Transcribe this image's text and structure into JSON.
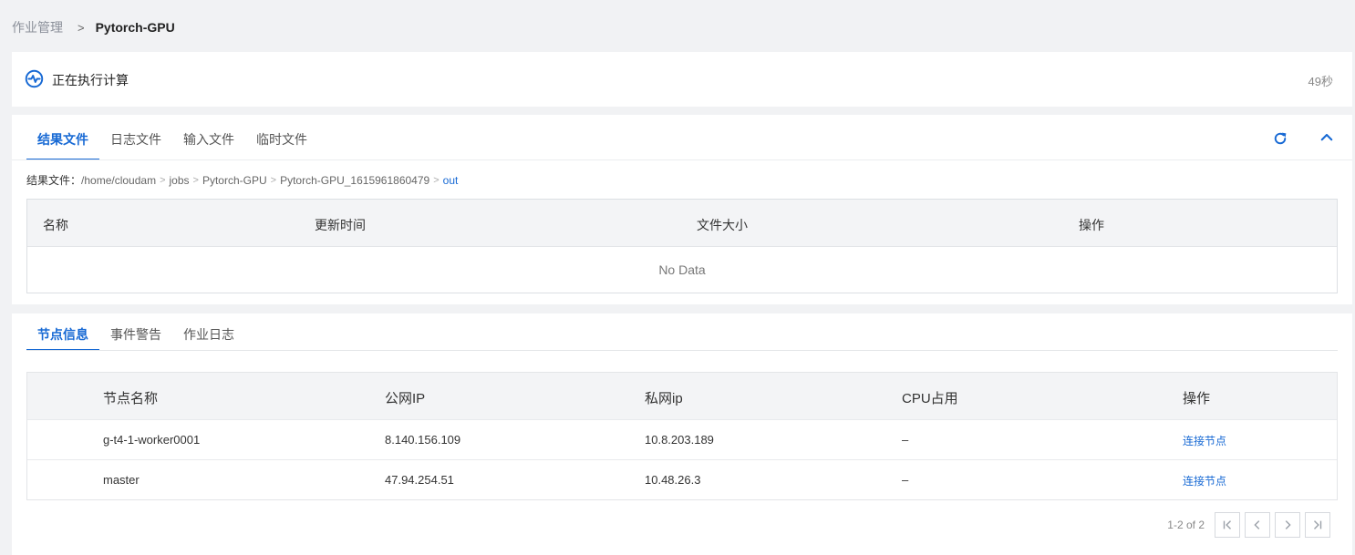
{
  "breadcrumb": {
    "parent": "作业管理",
    "separator": ">",
    "current": "Pytorch-GPU"
  },
  "status": {
    "icon": "activity-icon",
    "text": "正在执行计算",
    "elapsed": "49秒"
  },
  "files": {
    "tabs": [
      {
        "label": "结果文件",
        "active": true
      },
      {
        "label": "日志文件",
        "active": false
      },
      {
        "label": "输入文件",
        "active": false
      },
      {
        "label": "临时文件",
        "active": false
      }
    ],
    "path_label": "结果文件：",
    "path": [
      "/home/cloudam",
      "jobs",
      "Pytorch-GPU",
      "Pytorch-GPU_1615961860479",
      "out"
    ],
    "columns": [
      "名称",
      "更新时间",
      "文件大小",
      "操作"
    ],
    "empty_text": "No Data"
  },
  "nodes": {
    "tabs": [
      {
        "label": "节点信息",
        "active": true
      },
      {
        "label": "事件警告",
        "active": false
      },
      {
        "label": "作业日志",
        "active": false
      }
    ],
    "columns": [
      "节点名称",
      "公网IP",
      "私网ip",
      "CPU占用",
      "操作"
    ],
    "rows": [
      {
        "name": "g-t4-1-worker0001",
        "public_ip": "8.140.156.109",
        "private_ip": "10.8.203.189",
        "cpu": "–",
        "action": "连接节点"
      },
      {
        "name": "master",
        "public_ip": "47.94.254.51",
        "private_ip": "10.48.26.3",
        "cpu": "–",
        "action": "连接节点"
      }
    ],
    "pagination": {
      "info": "1-2 of 2"
    }
  },
  "colors": {
    "accent": "#1769d4",
    "background": "#f1f2f4",
    "header_bg": "#f3f4f6"
  }
}
